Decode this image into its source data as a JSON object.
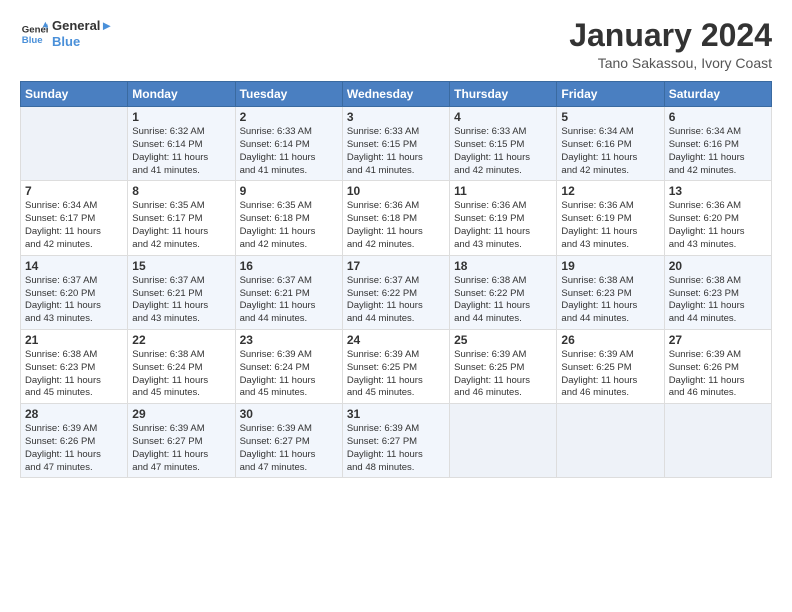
{
  "logo": {
    "line1": "General",
    "line2": "Blue"
  },
  "title": "January 2024",
  "location": "Tano Sakassou, Ivory Coast",
  "days_of_week": [
    "Sunday",
    "Monday",
    "Tuesday",
    "Wednesday",
    "Thursday",
    "Friday",
    "Saturday"
  ],
  "weeks": [
    [
      {
        "day": "",
        "info": ""
      },
      {
        "day": "1",
        "info": "Sunrise: 6:32 AM\nSunset: 6:14 PM\nDaylight: 11 hours\nand 41 minutes."
      },
      {
        "day": "2",
        "info": "Sunrise: 6:33 AM\nSunset: 6:14 PM\nDaylight: 11 hours\nand 41 minutes."
      },
      {
        "day": "3",
        "info": "Sunrise: 6:33 AM\nSunset: 6:15 PM\nDaylight: 11 hours\nand 41 minutes."
      },
      {
        "day": "4",
        "info": "Sunrise: 6:33 AM\nSunset: 6:15 PM\nDaylight: 11 hours\nand 42 minutes."
      },
      {
        "day": "5",
        "info": "Sunrise: 6:34 AM\nSunset: 6:16 PM\nDaylight: 11 hours\nand 42 minutes."
      },
      {
        "day": "6",
        "info": "Sunrise: 6:34 AM\nSunset: 6:16 PM\nDaylight: 11 hours\nand 42 minutes."
      }
    ],
    [
      {
        "day": "7",
        "info": "Sunrise: 6:34 AM\nSunset: 6:17 PM\nDaylight: 11 hours\nand 42 minutes."
      },
      {
        "day": "8",
        "info": "Sunrise: 6:35 AM\nSunset: 6:17 PM\nDaylight: 11 hours\nand 42 minutes."
      },
      {
        "day": "9",
        "info": "Sunrise: 6:35 AM\nSunset: 6:18 PM\nDaylight: 11 hours\nand 42 minutes."
      },
      {
        "day": "10",
        "info": "Sunrise: 6:36 AM\nSunset: 6:18 PM\nDaylight: 11 hours\nand 42 minutes."
      },
      {
        "day": "11",
        "info": "Sunrise: 6:36 AM\nSunset: 6:19 PM\nDaylight: 11 hours\nand 43 minutes."
      },
      {
        "day": "12",
        "info": "Sunrise: 6:36 AM\nSunset: 6:19 PM\nDaylight: 11 hours\nand 43 minutes."
      },
      {
        "day": "13",
        "info": "Sunrise: 6:36 AM\nSunset: 6:20 PM\nDaylight: 11 hours\nand 43 minutes."
      }
    ],
    [
      {
        "day": "14",
        "info": "Sunrise: 6:37 AM\nSunset: 6:20 PM\nDaylight: 11 hours\nand 43 minutes."
      },
      {
        "day": "15",
        "info": "Sunrise: 6:37 AM\nSunset: 6:21 PM\nDaylight: 11 hours\nand 43 minutes."
      },
      {
        "day": "16",
        "info": "Sunrise: 6:37 AM\nSunset: 6:21 PM\nDaylight: 11 hours\nand 44 minutes."
      },
      {
        "day": "17",
        "info": "Sunrise: 6:37 AM\nSunset: 6:22 PM\nDaylight: 11 hours\nand 44 minutes."
      },
      {
        "day": "18",
        "info": "Sunrise: 6:38 AM\nSunset: 6:22 PM\nDaylight: 11 hours\nand 44 minutes."
      },
      {
        "day": "19",
        "info": "Sunrise: 6:38 AM\nSunset: 6:23 PM\nDaylight: 11 hours\nand 44 minutes."
      },
      {
        "day": "20",
        "info": "Sunrise: 6:38 AM\nSunset: 6:23 PM\nDaylight: 11 hours\nand 44 minutes."
      }
    ],
    [
      {
        "day": "21",
        "info": "Sunrise: 6:38 AM\nSunset: 6:23 PM\nDaylight: 11 hours\nand 45 minutes."
      },
      {
        "day": "22",
        "info": "Sunrise: 6:38 AM\nSunset: 6:24 PM\nDaylight: 11 hours\nand 45 minutes."
      },
      {
        "day": "23",
        "info": "Sunrise: 6:39 AM\nSunset: 6:24 PM\nDaylight: 11 hours\nand 45 minutes."
      },
      {
        "day": "24",
        "info": "Sunrise: 6:39 AM\nSunset: 6:25 PM\nDaylight: 11 hours\nand 45 minutes."
      },
      {
        "day": "25",
        "info": "Sunrise: 6:39 AM\nSunset: 6:25 PM\nDaylight: 11 hours\nand 46 minutes."
      },
      {
        "day": "26",
        "info": "Sunrise: 6:39 AM\nSunset: 6:25 PM\nDaylight: 11 hours\nand 46 minutes."
      },
      {
        "day": "27",
        "info": "Sunrise: 6:39 AM\nSunset: 6:26 PM\nDaylight: 11 hours\nand 46 minutes."
      }
    ],
    [
      {
        "day": "28",
        "info": "Sunrise: 6:39 AM\nSunset: 6:26 PM\nDaylight: 11 hours\nand 47 minutes."
      },
      {
        "day": "29",
        "info": "Sunrise: 6:39 AM\nSunset: 6:27 PM\nDaylight: 11 hours\nand 47 minutes."
      },
      {
        "day": "30",
        "info": "Sunrise: 6:39 AM\nSunset: 6:27 PM\nDaylight: 11 hours\nand 47 minutes."
      },
      {
        "day": "31",
        "info": "Sunrise: 6:39 AM\nSunset: 6:27 PM\nDaylight: 11 hours\nand 48 minutes."
      },
      {
        "day": "",
        "info": ""
      },
      {
        "day": "",
        "info": ""
      },
      {
        "day": "",
        "info": ""
      }
    ]
  ]
}
